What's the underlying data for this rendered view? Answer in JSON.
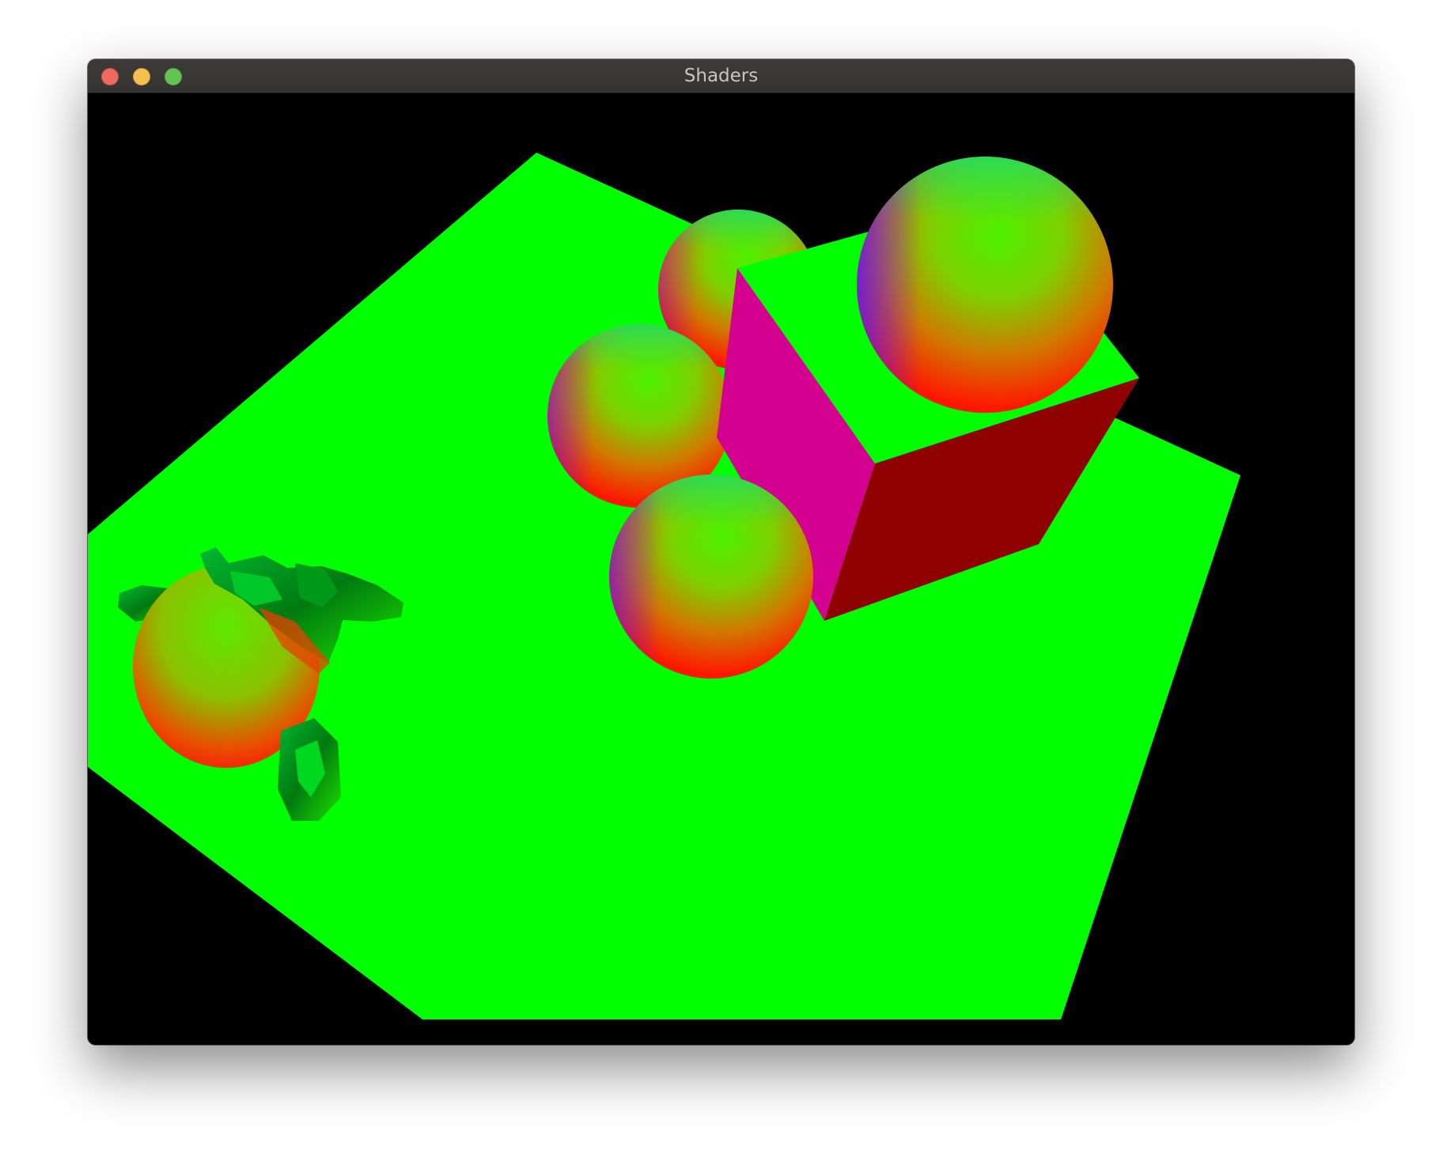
{
  "window": {
    "title": "Shaders",
    "buttons": [
      {
        "name": "close",
        "color": "#ed6a5e"
      },
      {
        "name": "minimize",
        "color": "#f4bf4f"
      },
      {
        "name": "zoom",
        "color": "#61c554"
      }
    ]
  },
  "scene": {
    "background_color": "#000000",
    "ground_plane_color": "#00ff00",
    "cube_colors": {
      "top": "#00ff00",
      "left_face": "#d4008f",
      "right_face": "#8f0000"
    },
    "objects": [
      "ground-plane",
      "monkey-head",
      "sphere",
      "sphere",
      "sphere",
      "sphere",
      "cube",
      "sphere"
    ]
  }
}
